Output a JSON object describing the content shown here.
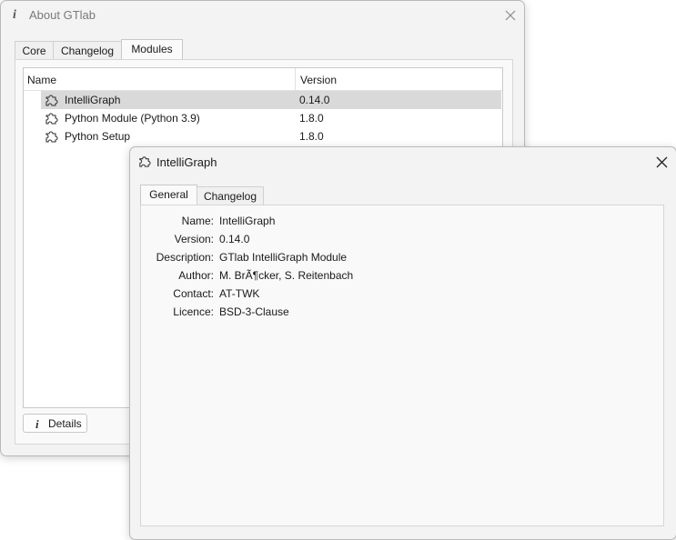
{
  "about_window": {
    "title": "About GTlab",
    "title_icon": "info-icon",
    "tabs": [
      {
        "label": "Core"
      },
      {
        "label": "Changelog"
      },
      {
        "label": "Modules",
        "active": true
      }
    ],
    "table": {
      "columns": [
        "Name",
        "Version"
      ],
      "rows": [
        {
          "name": "IntelliGraph",
          "version": "0.14.0",
          "icon": "plugin-icon",
          "selected": true
        },
        {
          "name": "Python Module (Python 3.9)",
          "version": "1.8.0",
          "icon": "plugin-icon"
        },
        {
          "name": "Python Setup",
          "version": "1.8.0",
          "icon": "plugin-icon"
        }
      ]
    },
    "details_button": "Details"
  },
  "detail_window": {
    "title": "IntelliGraph",
    "title_icon": "plugin-icon",
    "tabs": [
      {
        "label": "General",
        "active": true
      },
      {
        "label": "Changelog"
      }
    ],
    "properties": [
      {
        "label": "Name:",
        "value": "IntelliGraph"
      },
      {
        "label": "Version:",
        "value": "0.14.0"
      },
      {
        "label": "Description:",
        "value": "GTlab IntelliGraph Module"
      },
      {
        "label": "Author:",
        "value": "M. BrÃ¶cker, S. Reitenbach"
      },
      {
        "label": "Contact:",
        "value": "AT-TWK"
      },
      {
        "label": "Licence:",
        "value": "BSD-3-Clause"
      }
    ]
  }
}
